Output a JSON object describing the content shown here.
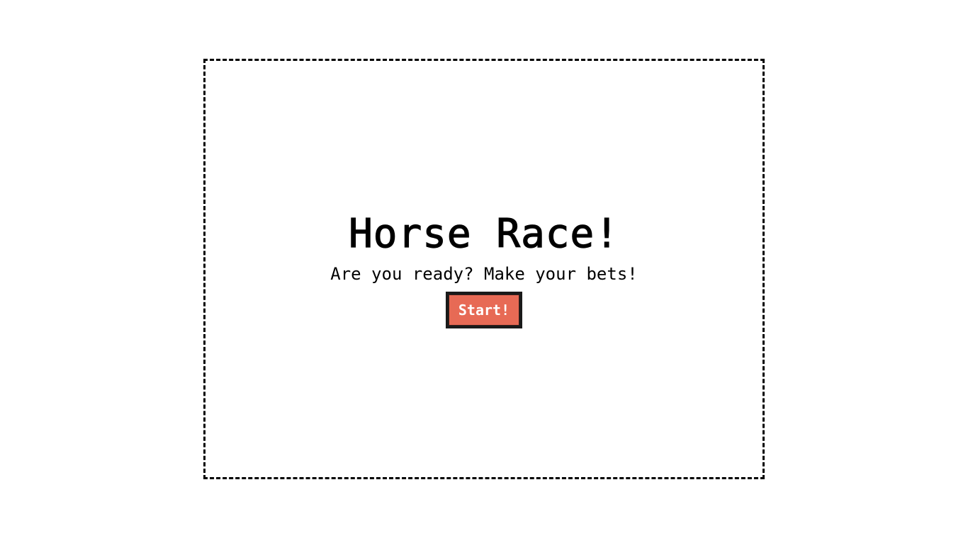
{
  "game": {
    "title": "Horse Race!",
    "subtitle": "Are you ready? Make your bets!",
    "start_label": "Start!"
  },
  "colors": {
    "button_bg": "#e76a55",
    "button_border": "#1a1a1a",
    "text": "#000000",
    "background": "#ffffff"
  }
}
